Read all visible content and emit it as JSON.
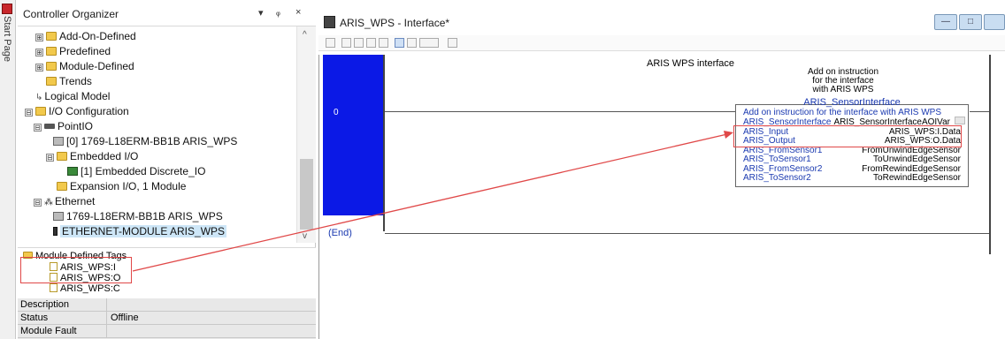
{
  "start_tab": {
    "label": "Start Page"
  },
  "organizer": {
    "title": "Controller Organizer",
    "pin_glyph": "▾",
    "float_glyph": "ᵩ",
    "close_glyph": "×",
    "tree": [
      {
        "label": "Add-On-Defined",
        "icon": "folder-icon",
        "expander": "⊞"
      },
      {
        "label": "Predefined",
        "icon": "folder-icon",
        "expander": "⊞"
      },
      {
        "label": "Module-Defined",
        "icon": "folder-icon",
        "expander": "⊞"
      },
      {
        "label": "Trends",
        "icon": "folder-icon"
      },
      {
        "label": "Logical Model",
        "icon": "logical-model-icon"
      },
      {
        "label": "I/O Configuration",
        "icon": "folder-icon",
        "expander": "⊟"
      },
      {
        "label": "PointIO",
        "icon": "backplane-icon",
        "expander": "⊟"
      },
      {
        "label": "[0] 1769-L18ERM-BB1B ARIS_WPS",
        "icon": "controller-icon"
      },
      {
        "label": "Embedded I/O",
        "icon": "folder-icon",
        "expander": "⊟"
      },
      {
        "label": "[1] Embedded Discrete_IO",
        "icon": "io-module-icon"
      },
      {
        "label": "Expansion I/O, 1 Module",
        "icon": "folder-icon"
      },
      {
        "label": "Ethernet",
        "icon": "ethernet-icon",
        "expander": "⊟"
      },
      {
        "label": "1769-L18ERM-BB1B ARIS_WPS",
        "icon": "controller-icon"
      },
      {
        "label": "ETHERNET-MODULE ARIS_WPS",
        "icon": "ethernet-module-icon",
        "selected": true
      }
    ],
    "scroll_up": "^",
    "scroll_down": "v"
  },
  "tags": {
    "header": "Module Defined Tags",
    "items": [
      "ARIS_WPS:I",
      "ARIS_WPS:O",
      "ARIS_WPS:C"
    ]
  },
  "properties": [
    {
      "key": "Description",
      "value": ""
    },
    {
      "key": "Status",
      "value": "Offline"
    },
    {
      "key": "Module Fault",
      "value": ""
    }
  ],
  "editor": {
    "title": "ARIS_WPS - Interface*",
    "min_glyph": "—",
    "max_glyph": "□",
    "rung": {
      "number": "0",
      "comment": "ARIS WPS interface",
      "aoi_comment": [
        "Add on instruction",
        "for the interface",
        "with ARIS WPS"
      ],
      "end_label": "(End)"
    },
    "aoi": {
      "name": "ARIS_SensorInterface",
      "description": "Add on instruction for the interface with ARIS WPS",
      "params": [
        {
          "name": "ARIS_SensorInterface",
          "value": "ARIS_SensorInterfaceAOIVar"
        },
        {
          "name": "ARIS_Input",
          "value": "ARIS_WPS:I.Data"
        },
        {
          "name": "ARIS_Output",
          "value": "ARIS_WPS:O.Data"
        },
        {
          "name": "ARIS_FromSensor1",
          "value": "FromUnwindEdgeSensor"
        },
        {
          "name": "ARIS_ToSensor1",
          "value": "ToUnwindEdgeSensor"
        },
        {
          "name": "ARIS_FromSensor2",
          "value": "FromRewindEdgeSensor"
        },
        {
          "name": "ARIS_ToSensor2",
          "value": "ToRewindEdgeSensor"
        }
      ]
    }
  },
  "colors": {
    "rung_select": "#0b19e6",
    "highlight": "#e04848",
    "aoi_text": "#1a39b0"
  }
}
